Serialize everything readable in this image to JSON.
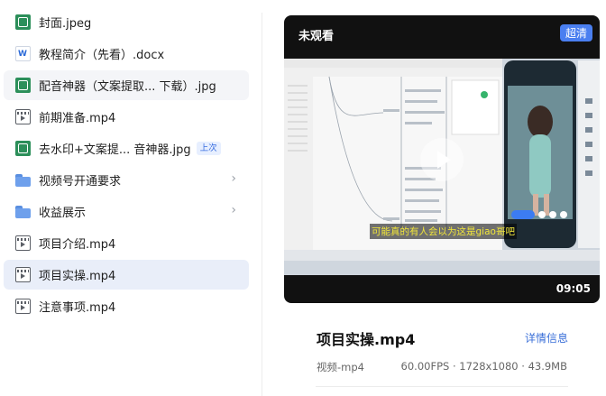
{
  "files": [
    {
      "name": "封面.jpeg",
      "icon": "image-file-icon",
      "kind": "image",
      "state": ""
    },
    {
      "name": "教程简介（先看）.docx",
      "icon": "word-file-icon",
      "kind": "word",
      "state": ""
    },
    {
      "name": "配音神器（文案提取...  下载）.jpg",
      "icon": "image-file-icon",
      "kind": "image",
      "state": "hover"
    },
    {
      "name": "前期准备.mp4",
      "icon": "video-file-icon",
      "kind": "video",
      "state": ""
    },
    {
      "name": "去水印+文案提...  音神器.jpg",
      "icon": "image-file-icon",
      "kind": "image",
      "state": "",
      "badge": "上次"
    },
    {
      "name": "视频号开通要求",
      "icon": "folder-icon",
      "kind": "folder",
      "state": "",
      "chevron": "›"
    },
    {
      "name": "收益展示",
      "icon": "folder-icon",
      "kind": "folder",
      "state": "",
      "chevron": "›"
    },
    {
      "name": "项目介绍.mp4",
      "icon": "video-file-icon",
      "kind": "video",
      "state": ""
    },
    {
      "name": "项目实操.mp4",
      "icon": "video-file-icon",
      "kind": "video",
      "state": "selected"
    },
    {
      "name": "注意事项.mp4",
      "icon": "video-file-icon",
      "kind": "video",
      "state": ""
    }
  ],
  "preview": {
    "status": "未观看",
    "quality": "超清",
    "duration": "09:05",
    "subtitle": "可能真的有人会以为这是giao哥吧"
  },
  "details": {
    "title": "项目实操.mp4",
    "link": "详情信息",
    "type": "视频-mp4",
    "meta": "60.00FPS · 1728x1080 · 43.9MB"
  },
  "colors": {
    "accent": "#4a7ff0",
    "selected_bg": "#e9eef9",
    "link": "#3a6fd8"
  }
}
